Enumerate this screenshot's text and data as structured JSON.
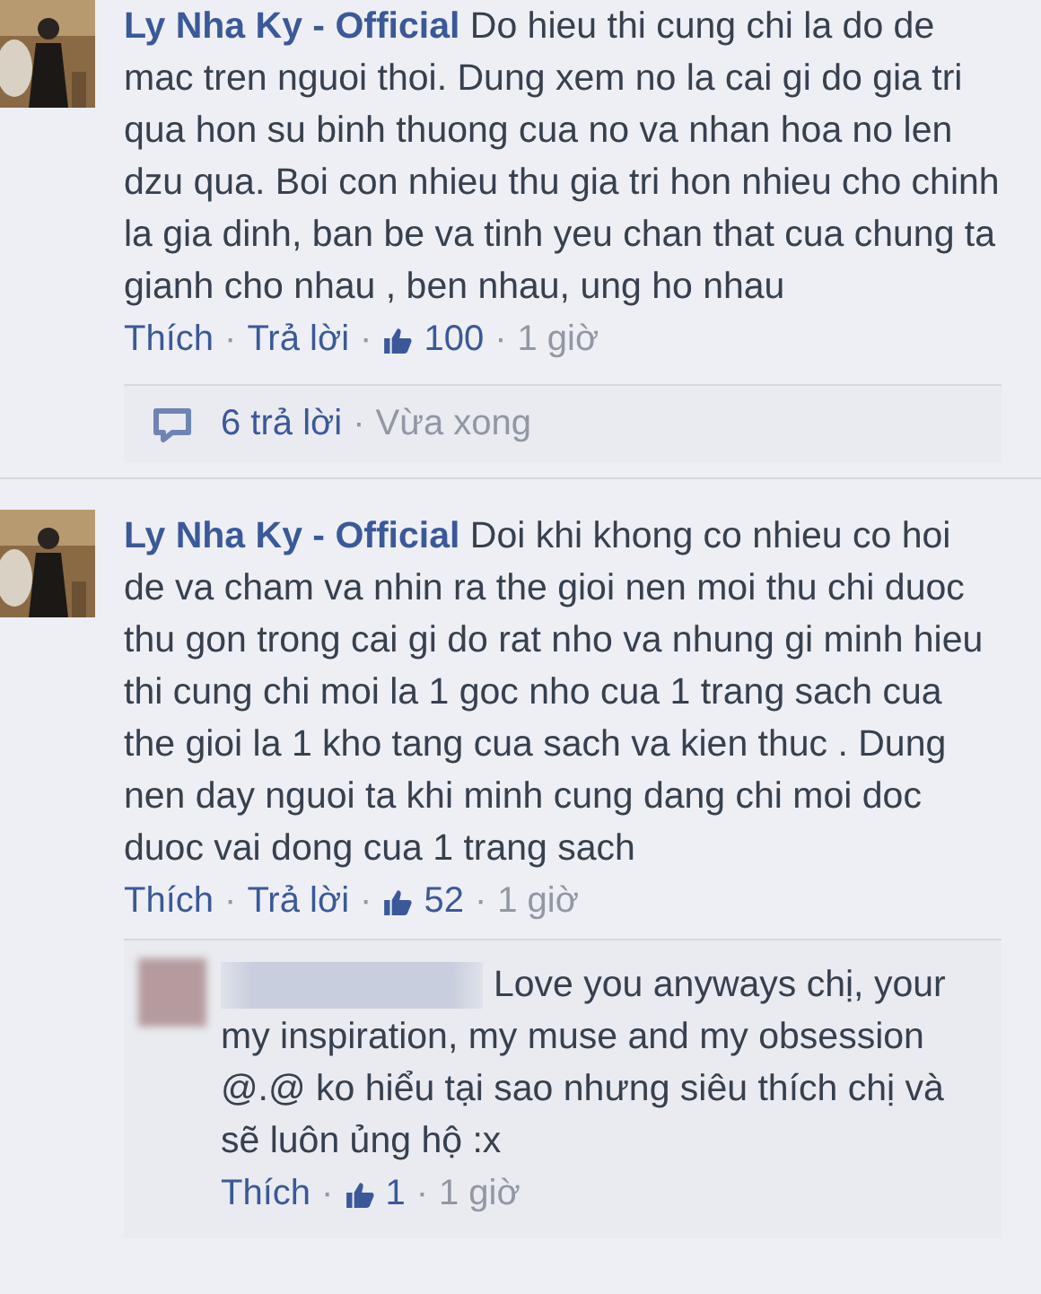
{
  "separator": "·",
  "comments": [
    {
      "author": "Ly Nha Ky - Official",
      "text": "Do hieu thi cung chi la do de mac tren nguoi thoi. Dung xem no la cai gi do gia tri qua hon su binh thuong cua no va nhan hoa no len dzu qua. Boi con nhieu thu gia tri hon nhieu cho chinh la gia dinh, ban be va tinh yeu chan that cua chung ta gianh cho nhau , ben nhau, ung ho nhau",
      "like_label": "Thích",
      "reply_label": "Trả lời",
      "likes": "100",
      "time": "1 giờ",
      "replies_summary": {
        "count": "6 trả lời",
        "time": "Vừa xong"
      }
    },
    {
      "author": "Ly Nha Ky - Official",
      "text": "Doi khi khong co nhieu co hoi de va cham va nhin ra the gioi nen moi thu chi duoc thu gon trong cai gi do rat nho va nhung gi minh hieu thi cung chi moi la 1 goc nho cua 1 trang sach cua the gioi la 1 kho tang cua sach va kien thuc . Dung nen day nguoi ta khi minh cung dang chi moi doc duoc vai dong cua 1 trang sach",
      "like_label": "Thích",
      "reply_label": "Trả lời",
      "likes": "52",
      "time": "1 giờ",
      "replies": [
        {
          "text": "Love you anyways chị, your my inspiration, my muse and my obsession @.@ ko hiểu tại sao nhưng siêu thích chị và sẽ luôn ủng hộ :x",
          "like_label": "Thích",
          "likes": "1",
          "time": "1 giờ"
        }
      ]
    }
  ]
}
